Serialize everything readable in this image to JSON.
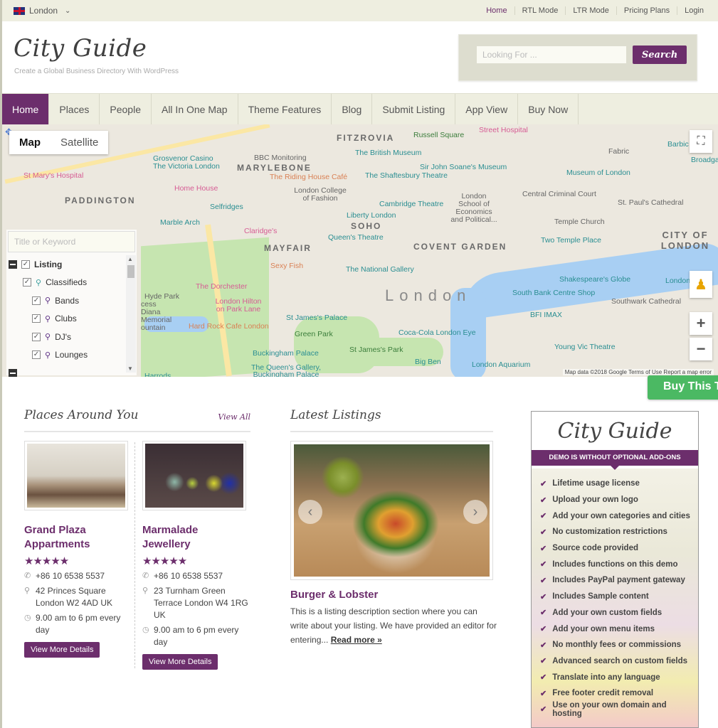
{
  "topbar": {
    "city": "London",
    "links": [
      "Home",
      "RTL Mode",
      "LTR Mode",
      "Pricing Plans",
      "Login"
    ]
  },
  "header": {
    "logo": "City Guide",
    "tagline": "Create a Global Business Directory With WordPress",
    "search_placeholder": "Looking For ...",
    "search_button": "Search"
  },
  "nav": {
    "items": [
      "Home",
      "Places",
      "People",
      "All In One Map",
      "Theme Features",
      "Blog",
      "Submit Listing",
      "App View",
      "Buy Now"
    ],
    "active": "Home"
  },
  "map": {
    "type_buttons": [
      "Map",
      "Satellite"
    ],
    "active_type": "Map",
    "filter_placeholder": "Title or Keyword",
    "tree": [
      {
        "label": "Listing",
        "level": 0,
        "checked": true
      },
      {
        "label": "Classifieds",
        "level": 1,
        "checked": true
      },
      {
        "label": "Bands",
        "level": 2,
        "checked": true
      },
      {
        "label": "Clubs",
        "level": 2,
        "checked": true
      },
      {
        "label": "DJ's",
        "level": 2,
        "checked": true
      },
      {
        "label": "Lounges",
        "level": 2,
        "checked": true
      }
    ],
    "labels": {
      "fitzrovia": "FITZROVIA",
      "russell_square": "Russell Square",
      "street_hospital": "Street Hospital",
      "grosvenor": "Grosvenor Casino",
      "victoria_london": "The Victoria London",
      "bbc": "BBC Monitoring",
      "marylebone": "MARYLEBONE",
      "riding_house": "The Riding House Café",
      "british_museum": "The British Museum",
      "soane": "Sir John Soane's Museum",
      "shaftesbury": "The Shaftesbury Theatre",
      "fabric": "Fabric",
      "barbican": "Barbic",
      "museum_london": "Museum of London",
      "broadgate": "Broadgat",
      "st_marys": "St Mary's Hospital",
      "paddington": "PADDINGTON",
      "home_house": "Home House",
      "lcf": "London College of Fashion",
      "central_criminal": "Central Criminal Court",
      "lse": "London School of Economics and Political...",
      "selfridges": "Selfridges",
      "cambridge_theatre": "Cambridge Theatre",
      "st_pauls": "St. Paul's Cathedral",
      "marble_arch": "Marble Arch",
      "liberty": "Liberty London",
      "temple_church": "Temple Church",
      "soho": "SOHO",
      "claridges": "Claridge's",
      "queens_theatre": "Queen's Theatre",
      "two_temple": "Two Temple Place",
      "city_of_london": "CITY OF LONDON",
      "mayfair": "MAYFAIR",
      "covent_garden": "COVENT GARDEN",
      "sexy_fish": "Sexy Fish",
      "national_gallery": "The National Gallery",
      "shakespeare": "Shakespeare's Globe",
      "london_bridge": "London Bridg",
      "dorchester": "The Dorchester",
      "hyde_park": "Hyde Park",
      "diana": "cess Diana Memorial ountain",
      "london_hilton": "London Hilton on Park Lane",
      "london": "London",
      "south_bank": "South Bank Centre Shop",
      "southwark": "Southwark Cathedral",
      "st_james_palace": "St James's Palace",
      "bfi": "BFI IMAX",
      "hard_rock": "Hard Rock Cafe London",
      "green_park": "Green Park",
      "london_eye": "Coca-Cola London Eye",
      "buckingham": "Buckingham Palace",
      "st_james_park": "St James's Park",
      "young_vic": "Young Vic Theatre",
      "queens_gallery": "The Queen's Gallery, Buckingham Palace",
      "big_ben": "Big Ben",
      "aquarium": "London Aquarium",
      "harrods": "Harrods"
    },
    "footer": "Map data ©2018 Google   Terms of Use   Report a map error"
  },
  "buy_tab": "Buy This T",
  "places": {
    "title": "Places Around You",
    "view_all": "View All",
    "cards": [
      {
        "name": "Grand Plaza Appartments",
        "rating": 5,
        "phone": "+86 10 6538 5537",
        "address": "42 Princes Square London W2 4AD UK",
        "hours": "9.00 am to 6 pm every day",
        "button": "View More Details"
      },
      {
        "name": "Marmalade Jewellery",
        "rating": 5,
        "phone": "+86 10 6538 5537",
        "address": "23 Turnham Green Terrace London W4 1RG UK",
        "hours": "9.00 am to 6 pm every day",
        "button": "View More Details"
      }
    ]
  },
  "latest": {
    "title": "Latest Listings",
    "item": {
      "name": "Burger & Lobster",
      "description": "This is a listing description section where you can write about your listing. We have provided an editor for entering...",
      "read_more": "Read more »"
    }
  },
  "promo": {
    "title": "City Guide",
    "band": "DEMO IS WITHOUT OPTIONAL ADD-ONS",
    "features": [
      "Lifetime usage license",
      "Upload your own logo",
      "Add your own categories and cities",
      "No customization restrictions",
      "Source code provided",
      "Includes functions on this demo",
      "Includes PayPal payment gateway",
      "Includes Sample content",
      "Add your own custom fields",
      "Add your own menu items",
      "No monthly fees or commissions",
      "Advanced search on custom fields",
      "Translate into any language",
      "Free footer credit removal",
      "Use on your own domain and hosting"
    ]
  },
  "colors": {
    "brand": "#6c2e6c",
    "buy_green": "#4bb963",
    "bar_bg": "#eeeee0"
  }
}
